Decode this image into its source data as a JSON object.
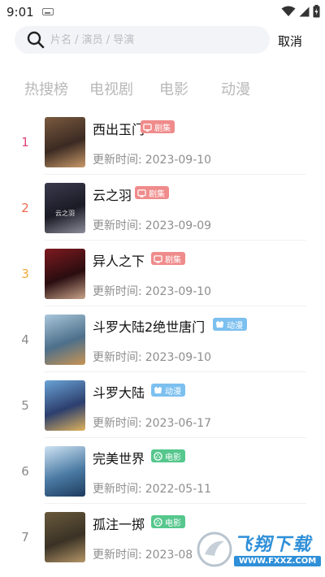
{
  "status_bar": {
    "time": "9:01"
  },
  "search": {
    "placeholder": "片名 / 演员 / 导演",
    "cancel_label": "取消"
  },
  "tabs": [
    {
      "label": "热搜榜",
      "active": true
    },
    {
      "label": "电视剧",
      "active": false
    },
    {
      "label": "电影",
      "active": false
    },
    {
      "label": "动漫",
      "active": false
    }
  ],
  "update_prefix": "更新时间:",
  "items": [
    {
      "rank": "1",
      "title": "西出玉门",
      "badge": "剧集",
      "badge_type": "series",
      "date": "2023-09-10",
      "poster_label": ""
    },
    {
      "rank": "2",
      "title": "云之羽",
      "badge": "剧集",
      "badge_type": "series",
      "date": "2023-09-09",
      "poster_label": "云之羽"
    },
    {
      "rank": "3",
      "title": "异人之下",
      "badge": "剧集",
      "badge_type": "series",
      "date": "2023-09-10",
      "poster_label": ""
    },
    {
      "rank": "4",
      "title": "斗罗大陆2绝世唐门",
      "badge": "动漫",
      "badge_type": "anime",
      "date": "2023-09-10",
      "poster_label": ""
    },
    {
      "rank": "5",
      "title": "斗罗大陆",
      "badge": "动漫",
      "badge_type": "anime",
      "date": "2023-06-17",
      "poster_label": ""
    },
    {
      "rank": "6",
      "title": "完美世界",
      "badge": "电影",
      "badge_type": "movie",
      "date": "2022-05-11",
      "poster_label": ""
    },
    {
      "rank": "7",
      "title": "孤注一掷",
      "badge": "电影",
      "badge_type": "movie",
      "date": "2023-08",
      "poster_label": ""
    }
  ],
  "colors": {
    "rank_1": "#e0457b",
    "rank_2": "#ef6a4e",
    "rank_3": "#f2a93b",
    "rank_other": "#8a8a8a",
    "badge_series": "#f08b8b",
    "badge_anime": "#7cc0ef",
    "badge_movie": "#56c78d",
    "watermark_blue": "#2f8fd8"
  },
  "watermark": {
    "brand": "飞翔下载",
    "url": "WWW.FXXZ.COM"
  }
}
